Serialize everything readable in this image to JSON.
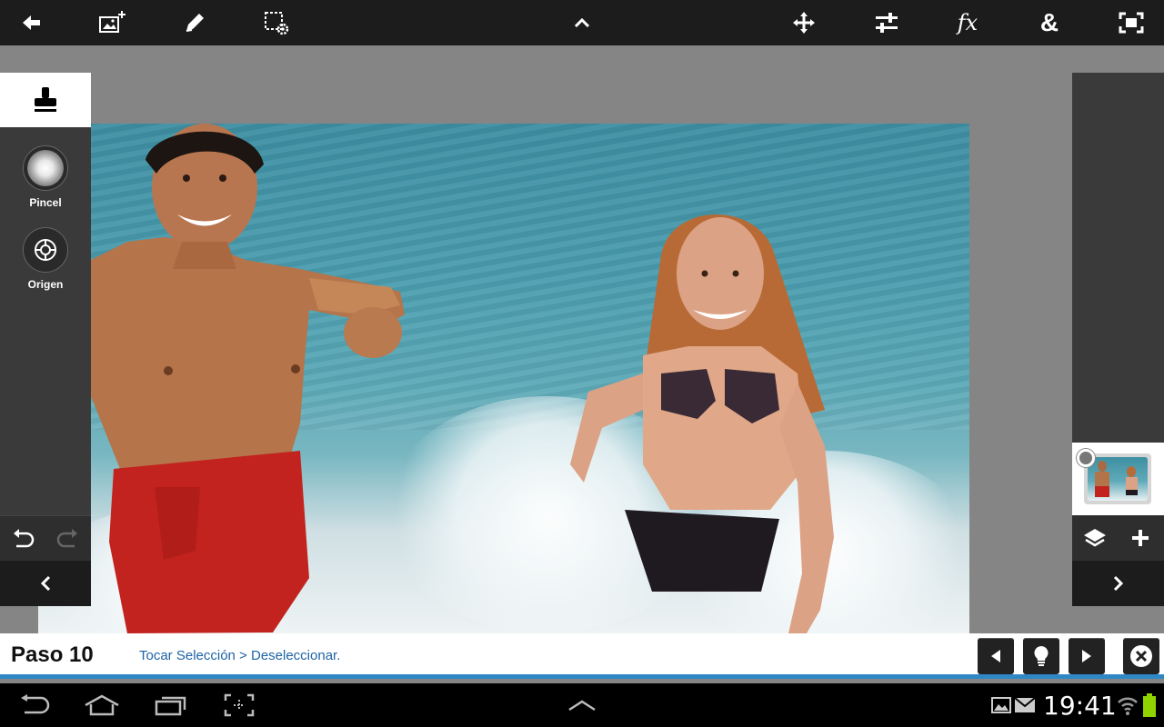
{
  "top_toolbar": {
    "icons": [
      "back-icon",
      "add-image-icon",
      "pencil-icon",
      "selection-settings-icon",
      "chevron-up-icon",
      "move-icon",
      "adjustments-icon",
      "fx-icon",
      "blend-icon",
      "fullscreen-icon"
    ],
    "fx_label": "fx",
    "blend_label": "&"
  },
  "left_panel": {
    "active_tool_icon": "stamp-icon",
    "tools": [
      {
        "label": "Pincel",
        "icon": "brush-icon"
      },
      {
        "label": "Origen",
        "icon": "crosshair-icon"
      }
    ],
    "undo_icon": "undo-icon",
    "redo_icon": "redo-icon",
    "nav_icon": "chevron-left-icon"
  },
  "right_panel": {
    "layer_icon": "layers-icon",
    "add_icon": "plus-icon",
    "nav_icon": "chevron-right-icon"
  },
  "tutorial": {
    "step": "Paso 10",
    "instruction": "Tocar Selección > Deseleccionar.",
    "buttons": [
      "previous-icon",
      "lightbulb-icon",
      "next-icon",
      "close-icon"
    ]
  },
  "system_bar": {
    "time": "19:41",
    "nav_icons": [
      "back-icon",
      "home-icon",
      "recents-icon",
      "screenshot-icon",
      "chevron-up-icon"
    ],
    "status_icons": [
      "gallery-icon",
      "mail-icon",
      "wifi-icon",
      "battery-icon"
    ]
  },
  "colors": {
    "toolbar_bg": "#1c1c1c",
    "canvas_bg": "#858585",
    "panel_bg": "#3a3a3a",
    "accent_blue": "#2e88c8",
    "instruction_text": "#1c63a5"
  }
}
